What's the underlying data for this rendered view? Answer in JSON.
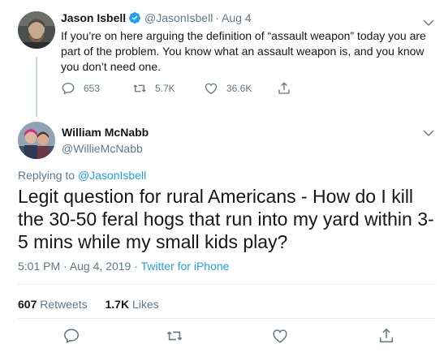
{
  "tweet1": {
    "name": "Jason Isbell",
    "handle": "@JasonIsbell",
    "separator": "·",
    "date": "Aug 4",
    "text": "If you’re on here arguing the definition of “assault weapon” today you are part of the problem. You know what an assault weapon is, and you know you don’t need one.",
    "replies": "653",
    "retweets": "5.7K",
    "likes": "36.6K"
  },
  "tweet2": {
    "name": "William McNabb",
    "handle": "@WillieMcNabb",
    "replying_prefix": "Replying to ",
    "replying_to": "@JasonIsbell",
    "text": "Legit question for rural Americans - How do I kill the 30-50 feral hogs that run into my yard within 3-5 mins while my small kids play?",
    "time": "5:01 PM · Aug 4, 2019 · ",
    "source": "Twitter for iPhone",
    "retweet_count": "607",
    "retweet_label": " Retweets",
    "like_count": "1.7K",
    "like_label": " Likes"
  },
  "colors": {
    "accent": "#1da1f2",
    "secondary_text": "#657786",
    "divider": "#e6ecf0"
  },
  "icons": {
    "verified": "verified-badge-icon",
    "reply": "reply-icon",
    "retweet": "retweet-icon",
    "like": "heart-icon",
    "share": "share-icon",
    "more": "chevron-down-icon"
  }
}
